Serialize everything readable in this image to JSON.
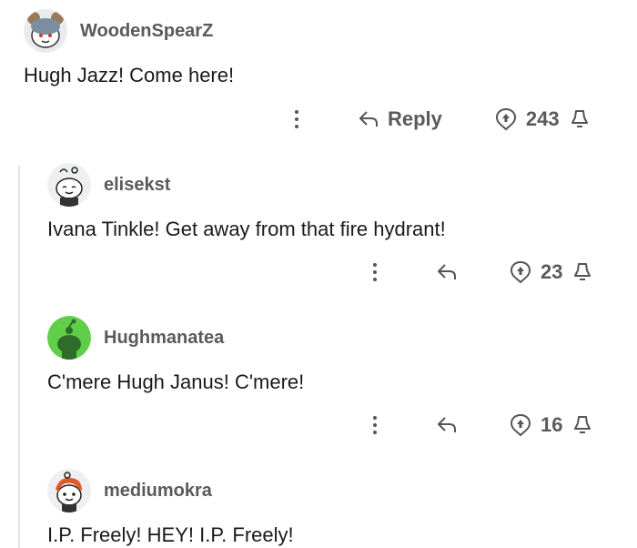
{
  "comments": [
    {
      "username": "WoodenSpearZ",
      "text": "Hugh Jazz! Come here!",
      "votes": "243",
      "reply_label": "Reply",
      "avatar_icon": "avatar-bear-icon"
    },
    {
      "username": "elisekst",
      "text": "Ivana Tinkle! Get away from that fire hydrant!",
      "votes": "23",
      "avatar_icon": "avatar-snoo-icon"
    },
    {
      "username": "Hughmanatea",
      "text": "C'mere Hugh Janus! C'mere!",
      "votes": "16",
      "avatar_icon": "avatar-green-snoo-icon"
    },
    {
      "username": "mediumokra",
      "text": "I.P. Freely! HEY! I.P. Freely!",
      "avatar_icon": "avatar-redhair-snoo-icon"
    }
  ],
  "colors": {
    "text": "#1a1a1b",
    "meta": "#5a5a5a",
    "thread_line": "#e3e3e3",
    "avatar_green": "#5fcf4a"
  }
}
